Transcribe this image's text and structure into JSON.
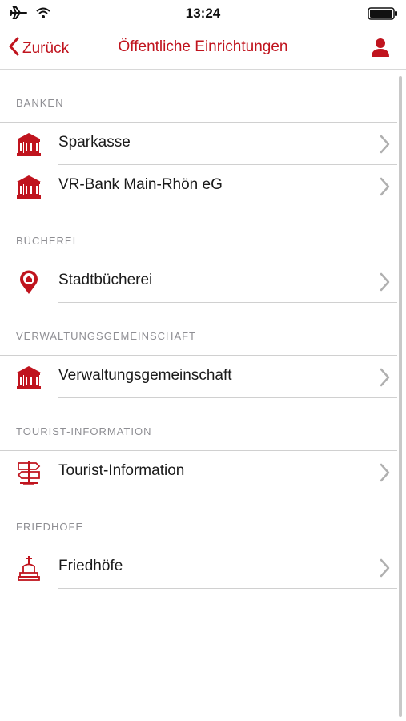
{
  "status_bar": {
    "time": "13:24"
  },
  "nav": {
    "back_label": "Zurück",
    "title": "Öffentliche Einrichtungen"
  },
  "sections": [
    {
      "header": "BANKEN",
      "items": [
        {
          "label": "Sparkasse",
          "icon": "bank-icon"
        },
        {
          "label": "VR-Bank Main-Rhön eG",
          "icon": "bank-icon"
        }
      ]
    },
    {
      "header": "BÜCHEREI",
      "items": [
        {
          "label": "Stadtbücherei",
          "icon": "location-pin-icon"
        }
      ]
    },
    {
      "header": "VERWALTUNGSGEMEINSCHAFT",
      "items": [
        {
          "label": "Verwaltungsgemeinschaft",
          "icon": "bank-icon"
        }
      ]
    },
    {
      "header": "TOURIST-INFORMATION",
      "items": [
        {
          "label": "Tourist-Information",
          "icon": "signpost-icon"
        }
      ]
    },
    {
      "header": "FRIEDHÖFE",
      "items": [
        {
          "label": "Friedhöfe",
          "icon": "gravestone-icon"
        }
      ]
    }
  ],
  "colors": {
    "accent": "#c0141e",
    "separator": "#d0d0d0",
    "section_text": "#8e8e93"
  }
}
